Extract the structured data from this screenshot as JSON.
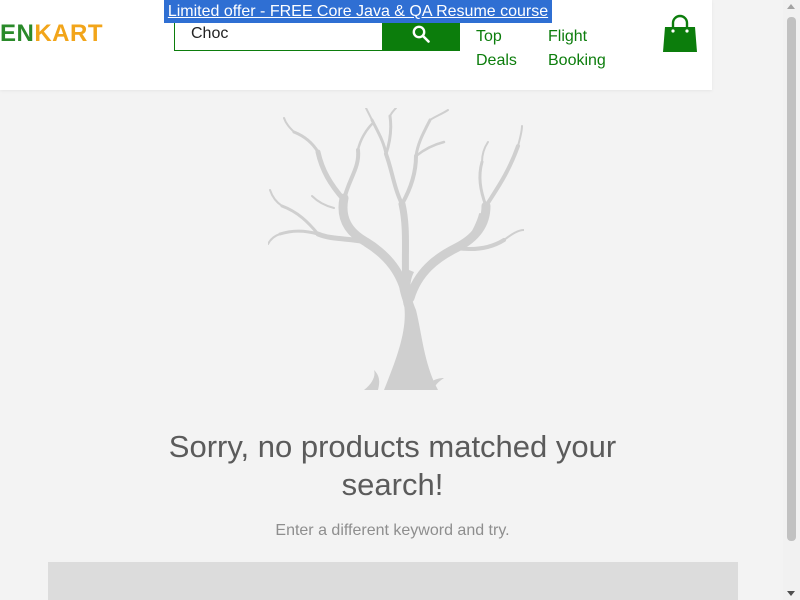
{
  "header": {
    "logo": {
      "part_green": "EN",
      "part_orange": "KART"
    },
    "promo_link": "Limited offer - FREE Core Java & QA Resume course",
    "search": {
      "value": "Choc",
      "placeholder": ""
    },
    "nav": [
      {
        "line1": "Top",
        "line2": "Deals"
      },
      {
        "line1": "Flight",
        "line2": "Booking"
      }
    ],
    "cart_icon": "shopping-bag-icon",
    "search_icon": "search-icon"
  },
  "empty_state": {
    "illustration": "bare-tree-illustration",
    "title": "Sorry, no products matched your search!",
    "subtitle": "Enter a different keyword and try."
  },
  "colors": {
    "brand_green": "#0c7d0c",
    "brand_orange": "#f2a51a",
    "promo_blue": "#2f6fd3",
    "page_bg": "#f3f3f3",
    "tree_gray": "#cfcfcf"
  }
}
